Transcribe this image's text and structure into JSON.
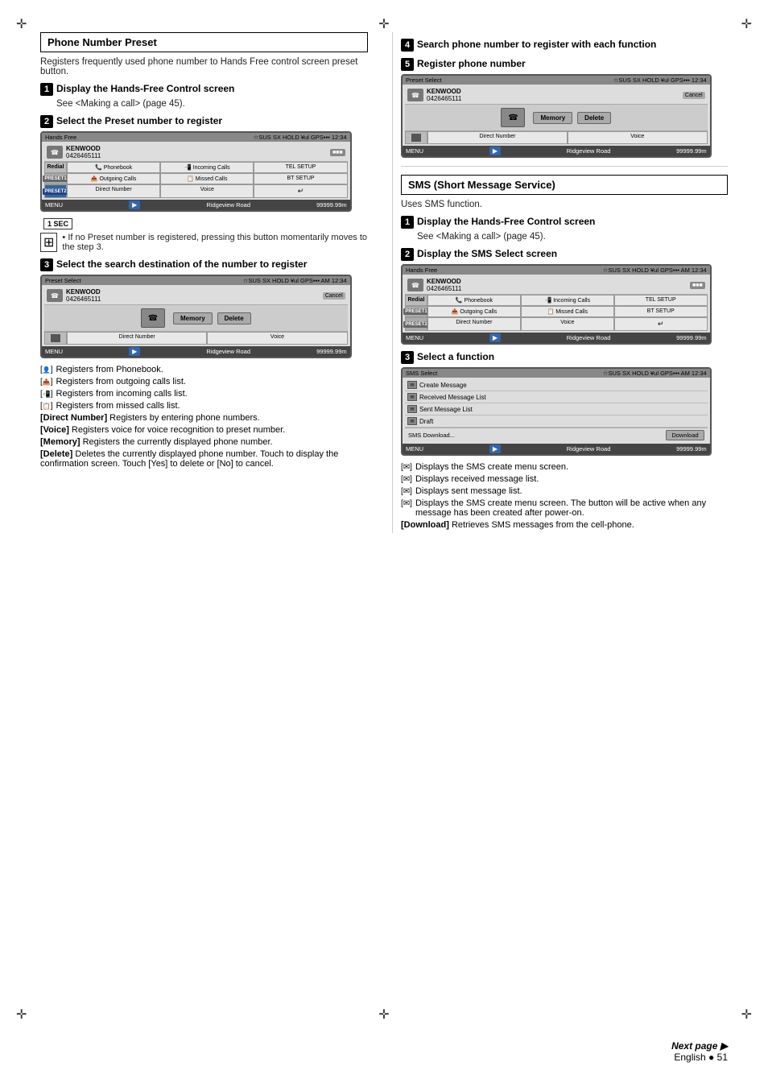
{
  "page": {
    "language": "English",
    "page_number": "51",
    "next_page_label": "Next page ▶",
    "center_cross": "✛"
  },
  "left_section": {
    "title": "Phone Number Preset",
    "intro": "Registers frequently used phone number to Hands Free control screen preset button.",
    "step1": {
      "number": "1",
      "heading": "Display the Hands-Free Control screen",
      "body": "See <Making a call> (page 45)."
    },
    "step2": {
      "number": "2",
      "heading": "Select the Preset number to register"
    },
    "screen1": {
      "title": "Hands Free",
      "statusbar": "SUB SX HOLD TEL GPS 12:34",
      "name": "KENWOOD",
      "number": "0426465111",
      "rows": [
        {
          "left": "Redial",
          "mid": "Phonebook",
          "mid2": "Incoming Calls",
          "right": "TEL SETUP"
        },
        {
          "left": "Preset1",
          "mid": "Outgoing Calls",
          "mid2": "Missed Calls",
          "right": "BT SETUP"
        },
        {
          "left": "Preset2",
          "mid": "Direct Number",
          "mid2": "Voice",
          "right": "↵"
        }
      ],
      "footer_left": "MENU",
      "footer_nav": "▶",
      "footer_road": "Ridgeview Road",
      "footer_dist": "99999.99m",
      "preset_indicator": "1 SEC"
    },
    "note": {
      "icon": "⊞",
      "text": "• If no Preset number is registered, pressing this button momentarily moves to the step 3."
    },
    "step3": {
      "number": "3",
      "heading": "Select the search destination of the number to register"
    },
    "screen2": {
      "title": "Preset Select",
      "statusbar": "SUB SX HOLD TEL GPS AM 12:34",
      "name": "KENWOOD",
      "number": "0426465111",
      "cancel": "Cancel",
      "btn_memory": "Memory",
      "btn_delete": "Delete",
      "rows_bottom": [
        {
          "left": "Direct Number",
          "right": "Voice"
        }
      ],
      "footer_left": "MENU",
      "footer_nav": "▶",
      "footer_road": "Ridgeview Road",
      "footer_dist": "99999.99m"
    },
    "bullets": [
      {
        "icon": "👤",
        "text": "Registers from Phonebook."
      },
      {
        "icon": "📞",
        "text": "Registers from outgoing calls list."
      },
      {
        "icon": "📲",
        "text": "Registers from incoming calls list."
      },
      {
        "icon": "📋",
        "text": "Registers from missed calls list."
      },
      {
        "key": "Direct Number",
        "text": "Registers by entering phone numbers."
      },
      {
        "key": "Voice",
        "text": "Registers voice for voice recognition to preset number."
      },
      {
        "key": "Memory",
        "text": "Registers the currently displayed phone number."
      },
      {
        "key": "Delete",
        "text": "Deletes the currently displayed phone number. Touch to display the confirmation screen. Touch [Yes] to delete or [No] to cancel."
      }
    ]
  },
  "right_section": {
    "step4": {
      "number": "4",
      "heading": "Search phone number to register with each function"
    },
    "step5": {
      "number": "5",
      "heading": "Register phone number"
    },
    "screen3": {
      "title": "Preset Select",
      "statusbar": "SUB SX HOLD TEL GPS 12:34",
      "name": "KENWOOD",
      "number": "0426465111",
      "cancel": "Cancel",
      "btn_memory": "Memory",
      "btn_delete": "Delete",
      "footer_left": "MENU",
      "footer_nav": "▶",
      "footer_road": "Ridgeview Road",
      "footer_dist": "99999.99m",
      "bottom_row": "Direct Number    Voice"
    },
    "sms_section": {
      "title": "SMS (Short Message Service)",
      "intro": "Uses SMS function.",
      "step1": {
        "number": "1",
        "heading": "Display the Hands-Free Control screen",
        "body": "See <Making a call> (page 45)."
      },
      "step2": {
        "number": "2",
        "heading": "Display the SMS Select screen"
      },
      "screen_sms1": {
        "title": "Hands Free",
        "statusbar": "SUB SX HOLD TEL GPS AM 12:34",
        "name": "KENWOOD",
        "number": "0426465111",
        "rows": [
          {
            "left": "Redial",
            "mid": "Phonebook",
            "mid2": "Incoming Calls",
            "right": "TEL SETUP"
          },
          {
            "left": "Preset1",
            "mid": "Outgoing Calls",
            "mid2": "Missed Calls",
            "right": "BT SETUP"
          },
          {
            "left": "Preset2",
            "mid": "Direct Number",
            "mid2": "Voice",
            "right": "↵"
          }
        ],
        "footer_left": "MENU",
        "footer_nav": "▶",
        "footer_road": "Ridgeview Road",
        "footer_dist": "99999.99m"
      },
      "step3": {
        "number": "3",
        "heading": "Select a function"
      },
      "screen_sms2": {
        "title": "SMS Select",
        "statusbar": "SUB SX HOLD TEL GPS AM 12:34",
        "items": [
          {
            "icon": "✉",
            "label": "Create Message"
          },
          {
            "icon": "✉",
            "label": "Received Message List"
          },
          {
            "icon": "✉",
            "label": "Sent Message List"
          },
          {
            "icon": "✉",
            "label": "Draft"
          }
        ],
        "sms_download": "SMS Download...",
        "download_btn": "Download",
        "footer_left": "MENU",
        "footer_nav": "▶",
        "footer_road": "Ridgeview Road",
        "footer_dist": "99999.99m"
      },
      "bullets": [
        {
          "icon": "✉",
          "text": "Displays the SMS create menu screen."
        },
        {
          "icon": "✉",
          "text": "Displays received message list."
        },
        {
          "icon": "✉",
          "text": "Displays sent message list."
        },
        {
          "icon": "✉",
          "text": "Displays the SMS create menu screen. The button will be active when any message has been created after power-on."
        },
        {
          "key": "Download",
          "text": "Retrieves SMS messages from the cell-phone."
        }
      ]
    }
  }
}
